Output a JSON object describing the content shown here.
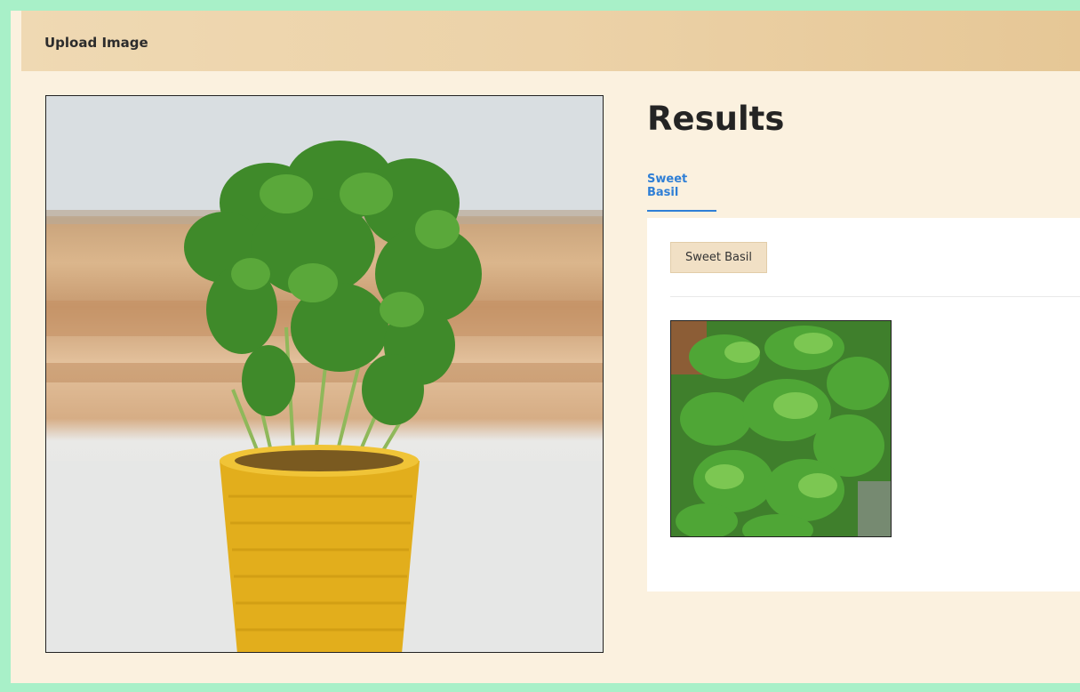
{
  "header": {
    "title": "Upload Image"
  },
  "results": {
    "title": "Results",
    "tabs": [
      {
        "label": "Sweet Basil",
        "active": true
      }
    ],
    "card": {
      "badge_label": "Sweet Basil"
    }
  },
  "colors": {
    "outer_border": "#a8f0c8",
    "page_background": "#fbf1df",
    "header_background": "#ecd2a8",
    "tab_accent": "#2f7fd6",
    "badge_background": "#f1e0c5"
  },
  "images": {
    "uploaded": "photo-basil-plant-in-yellow-pot",
    "result": "photo-sweet-basil-leaves"
  }
}
